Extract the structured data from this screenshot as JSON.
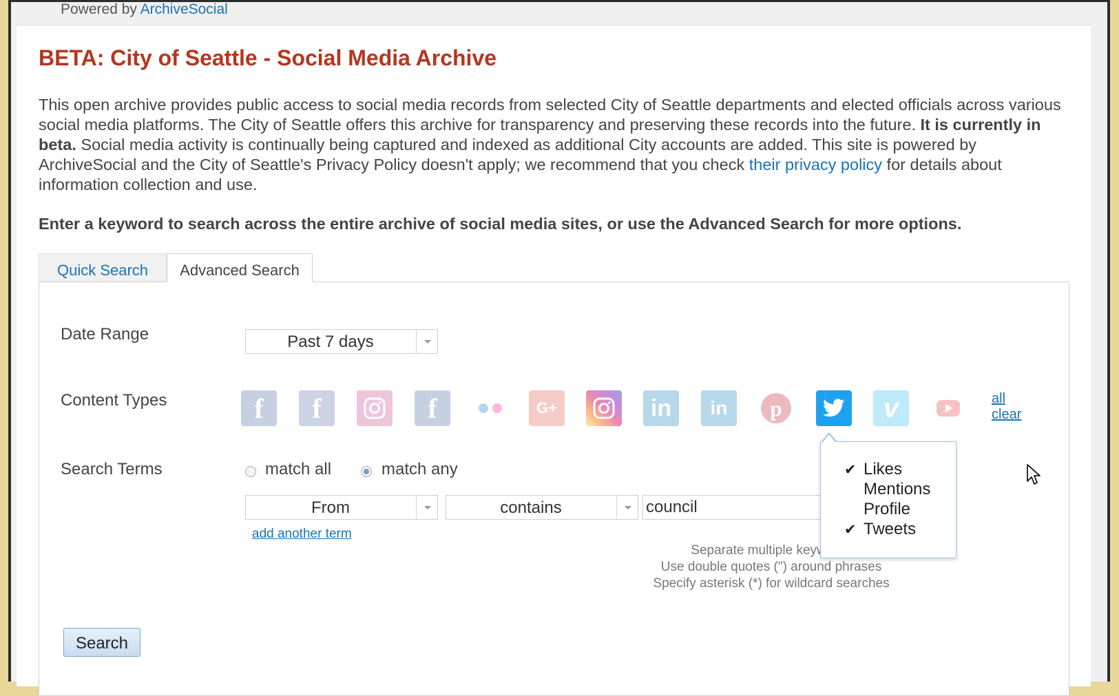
{
  "powered_by": {
    "prefix": "Powered by",
    "link": "ArchiveSocial"
  },
  "title": "BETA: City of Seattle - Social Media Archive",
  "intro": {
    "part1": "This open archive provides public access to social media records from selected City of Seattle departments and elected officials across various social media platforms. The City of Seattle offers this archive for transparency and preserving these records into the future. ",
    "bold": "It is currently in beta.",
    "part2": " Social media activity is continually being captured and indexed as additional City accounts are added. This site is powered by ArchiveSocial and the City of Seattle's Privacy Policy doesn't apply; we recommend that you check ",
    "link": "their privacy policy",
    "part3": " for details about information collection and use."
  },
  "instruction": "Enter a keyword to search across the entire archive of social media sites, or use the Advanced Search for more options.",
  "tabs": {
    "quick": "Quick Search",
    "advanced": "Advanced Search"
  },
  "date_range": {
    "label": "Date Range",
    "value": "Past 7 days"
  },
  "content_types": {
    "label": "Content Types",
    "icons": [
      "facebook-icon",
      "facebook-page-icon",
      "instagram-icon",
      "facebook-group-icon",
      "flickr-icon",
      "google-plus-icon",
      "instagram-color-icon",
      "linkedin-icon",
      "linkedin-company-icon",
      "pinterest-icon",
      "twitter-icon",
      "vimeo-icon",
      "youtube-icon"
    ],
    "all_link": "all",
    "clear_link": "clear",
    "colors": {
      "facebook": "#3b5998",
      "instagram": "#c13584",
      "flickr": "#ff0084",
      "google_plus": "#dd4b39",
      "linkedin": "#0077b5",
      "pinterest": "#bd081c",
      "twitter": "#1da1f2",
      "vimeo": "#1ab7ea",
      "youtube": "#e52d27"
    }
  },
  "search_terms": {
    "label": "Search Terms",
    "match_all": "match all",
    "match_any": "match any",
    "field": "From",
    "operator": "contains",
    "value": "council",
    "add_term": "add another term",
    "hints": [
      "Separate multiple keywords",
      "Use double quotes (\") around phrases",
      "Specify asterisk (*) for wildcard searches"
    ]
  },
  "twitter_popup": {
    "check_mark": "✔",
    "options": [
      {
        "label": "Likes",
        "checked": true
      },
      {
        "label": "Mentions",
        "checked": false
      },
      {
        "label": "Profile",
        "checked": false
      },
      {
        "label": "Tweets",
        "checked": true
      }
    ]
  },
  "search_button": "Search"
}
